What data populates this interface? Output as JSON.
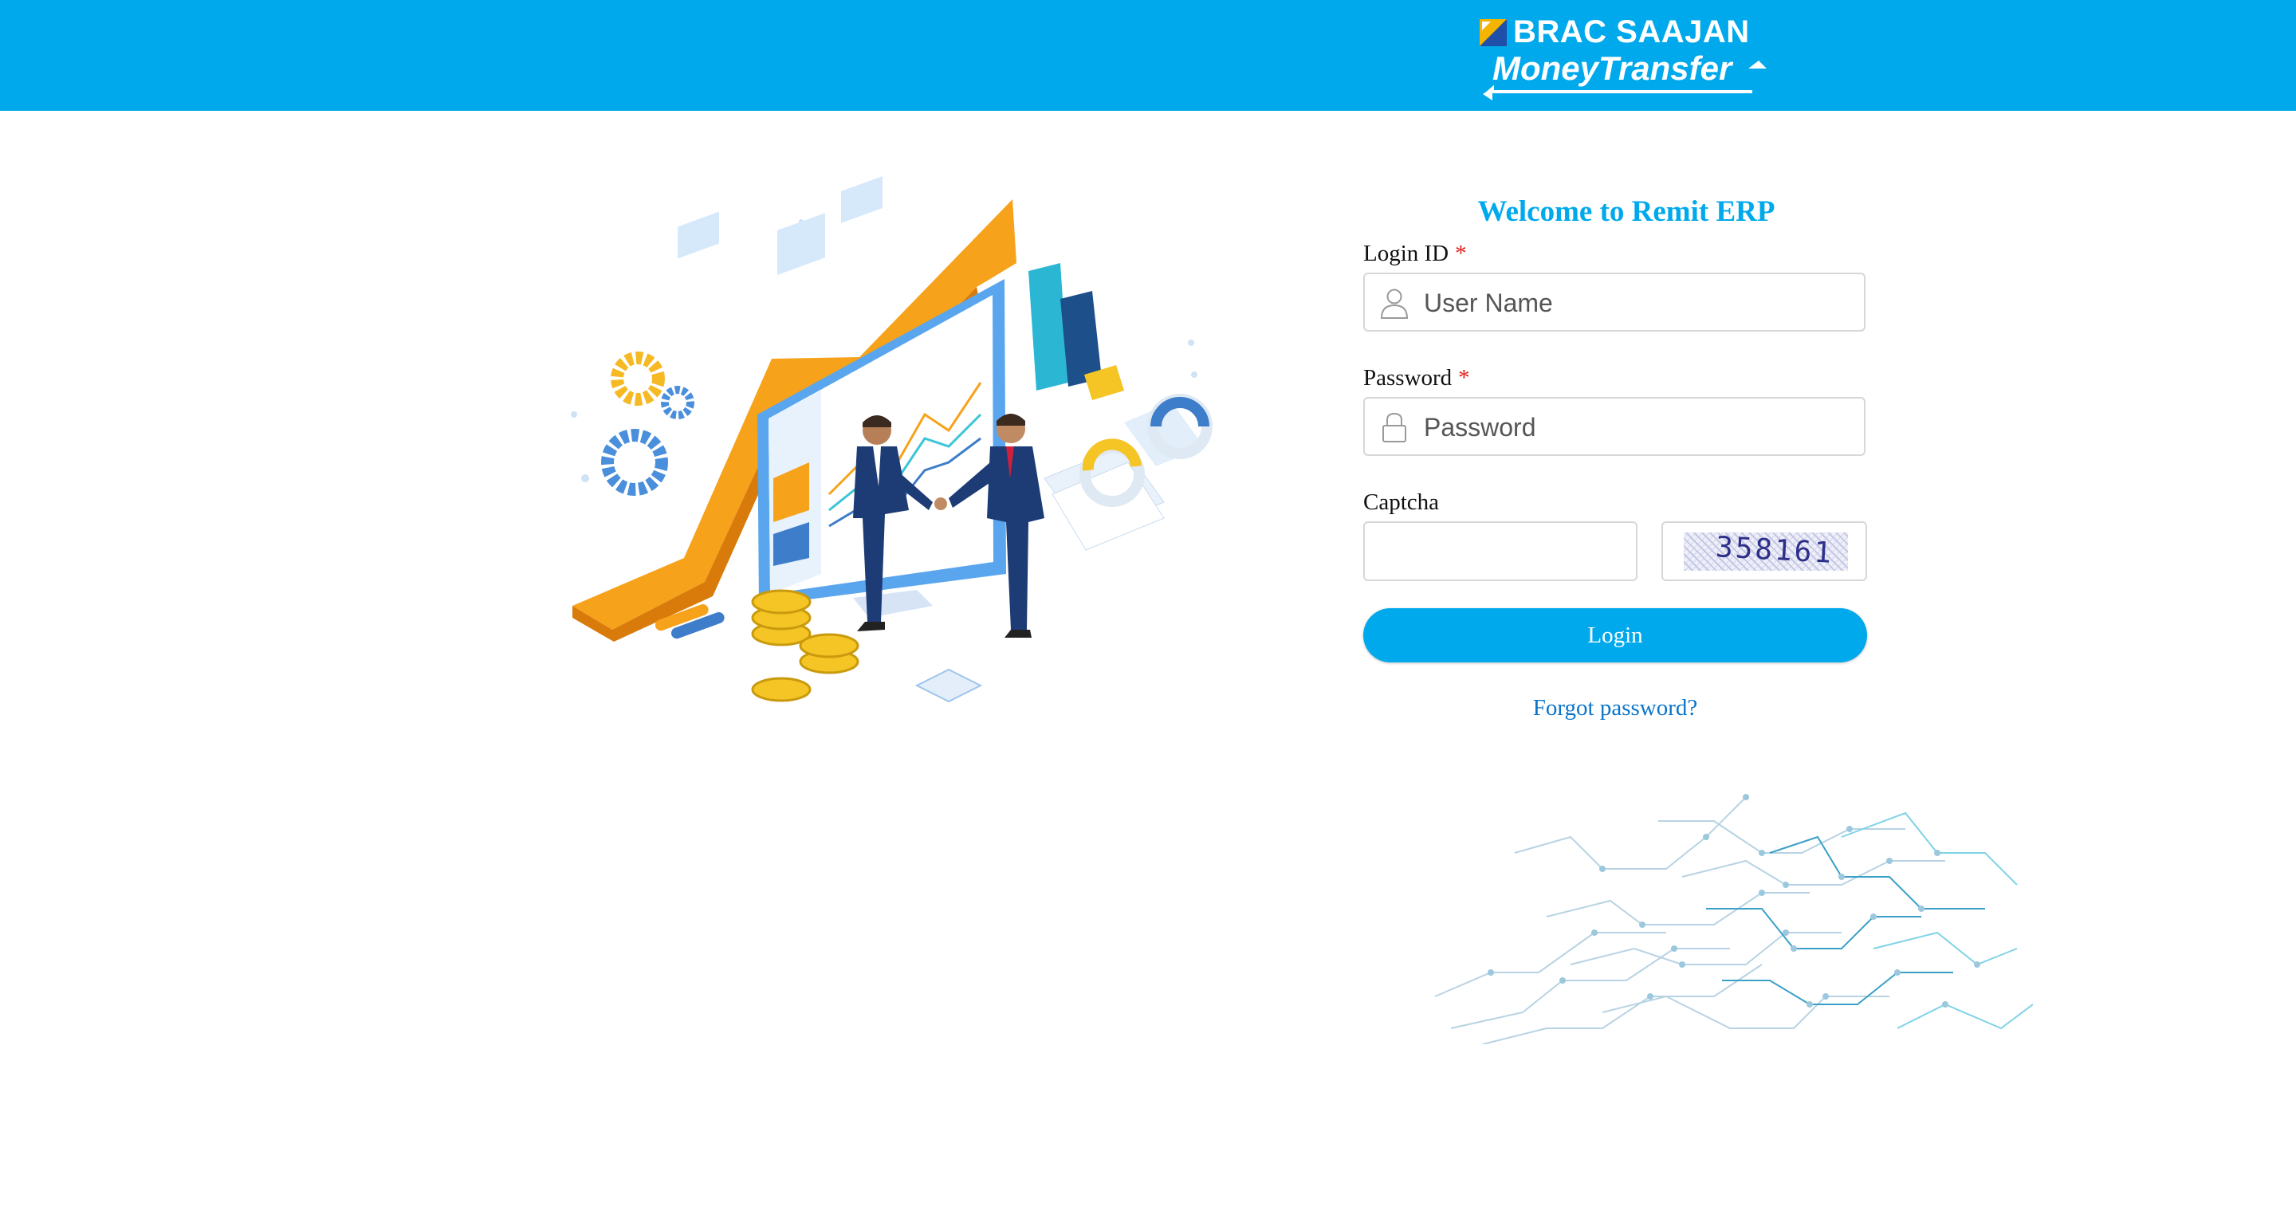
{
  "header": {
    "brand": "BRAC SAAJAN",
    "sub_brand": "MoneyTransfer",
    "background_color": "#00a9ec"
  },
  "login": {
    "title": "Welcome to Remit ERP",
    "login_id_label": "Login ID",
    "required_mark": "*",
    "username_placeholder": "User Name",
    "password_label": "Password",
    "password_placeholder": "Password",
    "captcha_label": "Captcha",
    "captcha_value": "",
    "captcha_code": "358161",
    "login_button": "Login",
    "forgot_link": "Forgot password?"
  },
  "icons": {
    "username": "user-icon",
    "password": "lock-icon"
  },
  "colors": {
    "accent": "#00a9ec",
    "link": "#0a74c9",
    "required": "#e02020"
  }
}
